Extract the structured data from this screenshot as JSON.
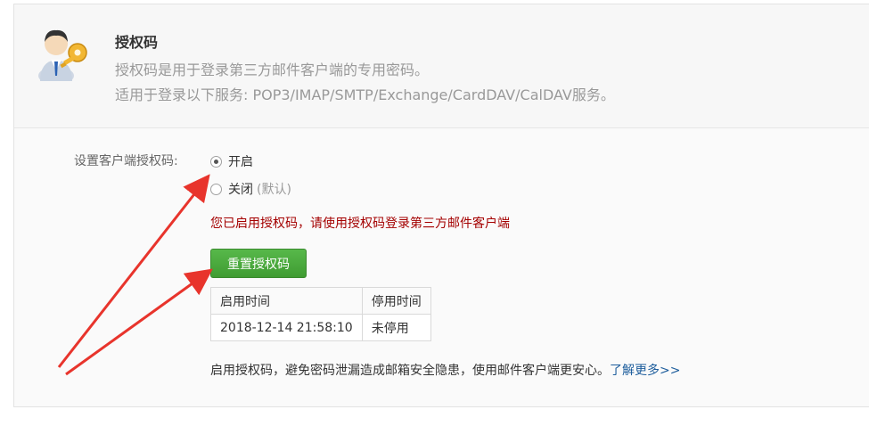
{
  "header": {
    "title": "授权码",
    "desc1": "授权码是用于登录第三方邮件客户端的专用密码。",
    "desc2": "适用于登录以下服务: POP3/IMAP/SMTP/Exchange/CardDAV/CalDAV服务。",
    "icon": "user-key-icon"
  },
  "setting": {
    "label": "设置客户端授权码:",
    "options": [
      {
        "label": "开启",
        "note": "",
        "checked": true
      },
      {
        "label": "关闭",
        "note": "(默认)",
        "checked": false
      }
    ],
    "notice": "您已启用授权码，请使用授权码登录第三方邮件客户端",
    "reset_button": "重置授权码"
  },
  "table": {
    "headers": [
      "启用时间",
      "停用时间"
    ],
    "rows": [
      [
        "2018-12-14 21:58:10",
        "未停用"
      ]
    ]
  },
  "footer": {
    "text": "启用授权码，避免密码泄漏造成邮箱安全隐患，使用邮件客户端更安心。",
    "link": "了解更多>>"
  },
  "colors": {
    "notice": "#a40000",
    "button": "#4aac3e",
    "link": "#1d5d9c",
    "arrow": "#e8342c"
  }
}
